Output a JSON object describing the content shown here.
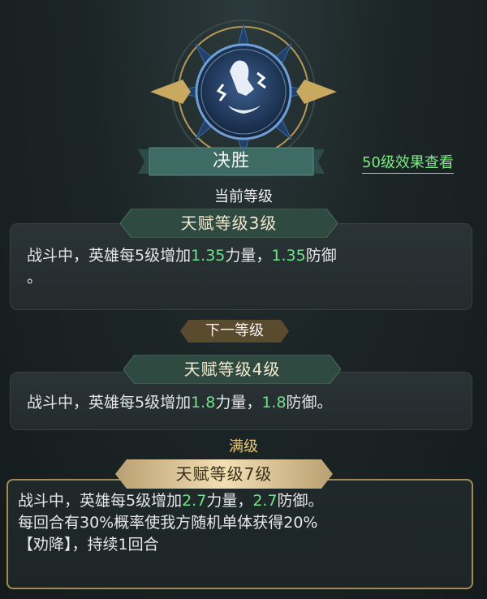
{
  "skill": {
    "name": "决胜",
    "icon": "lightning-fist-icon"
  },
  "view_link": "50级效果查看",
  "current": {
    "section_label": "当前等级",
    "level_label": "天赋等级3级",
    "desc_prefix": "战斗中，英雄每5级增加",
    "value1": "1.35",
    "mid_text": "力量，",
    "value2": "1.35",
    "desc_suffix": "防御",
    "desc_end": "。"
  },
  "next": {
    "section_label": "下一等级",
    "level_label": "天赋等级4级",
    "desc_prefix": "战斗中，英雄每5级增加",
    "value1": "1.8",
    "mid_text": "力量，",
    "value2": "1.8",
    "desc_suffix": "防御。"
  },
  "max": {
    "section_label": "满级",
    "level_label": "天赋等级7级",
    "desc_prefix": "战斗中，英雄每5级增加",
    "value1": "2.7",
    "mid_text": "力量，",
    "value2": "2.7",
    "desc_suffix": "防御。",
    "line2": "每回合有30%概率使我方随机单体获得20%",
    "line3": "【劝降】，持续1回合"
  },
  "colors": {
    "highlight": "#6fe38a",
    "link": "#7dea86",
    "gold": "#e9c77c",
    "banner_teal": "#3f6b65"
  }
}
